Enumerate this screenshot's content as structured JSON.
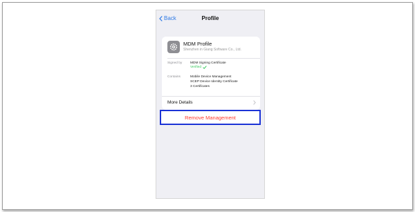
{
  "nav": {
    "back_label": "Back",
    "title": "Profile"
  },
  "profile": {
    "name": "MDM Profile",
    "subtitle": "Shenzhen in Giang Software Co., Ltd.",
    "signed_by_label": "Signed by",
    "signed_by_value": "MDM Signing Certificate",
    "verified_label": "Verified",
    "contains_label": "Contains",
    "contains_items": [
      "Mobile Device Management",
      "SCEP Device Identity Certificate",
      "3 Certificates"
    ],
    "more_details_label": "More Details"
  },
  "actions": {
    "remove_label": "Remove Management"
  },
  "colors": {
    "accent": "#2f7ae5",
    "destructive": "#ff3b30",
    "verified": "#34c759",
    "highlight_border": "#1b33d6"
  }
}
